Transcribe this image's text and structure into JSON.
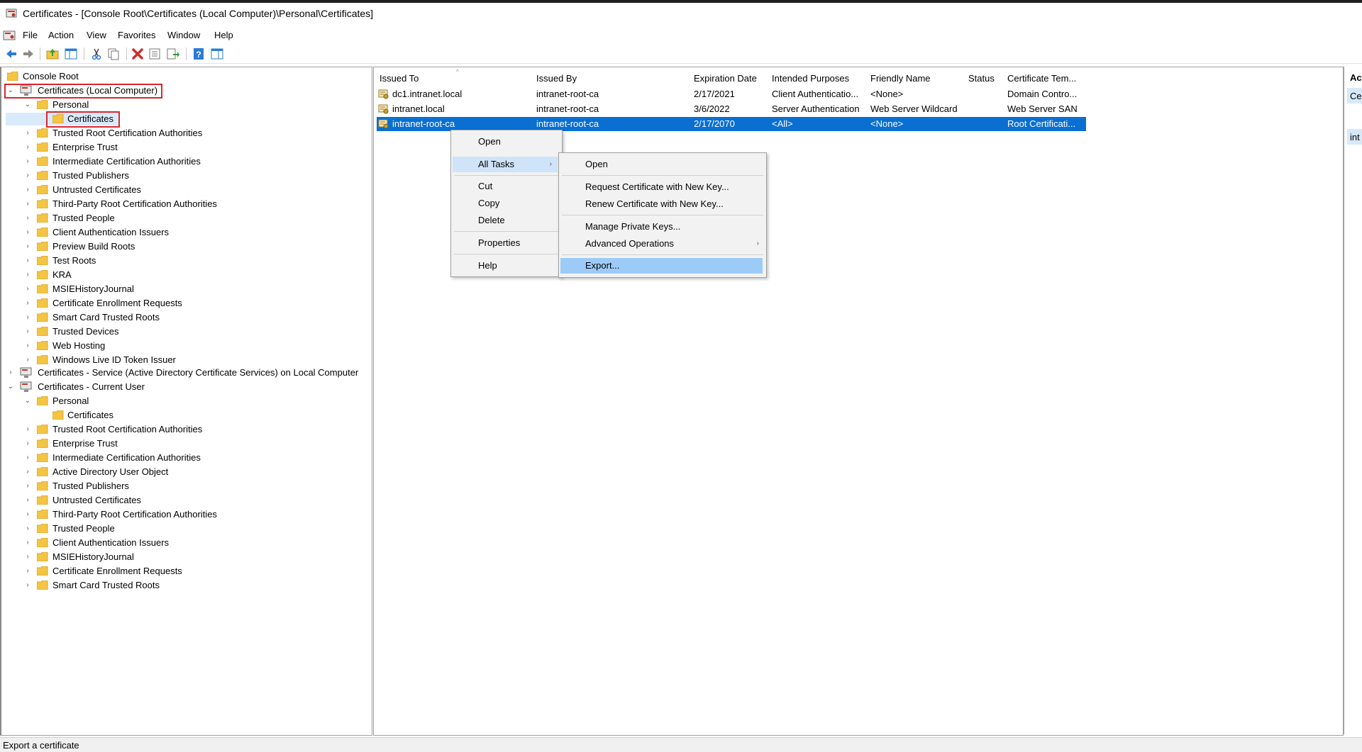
{
  "window": {
    "title": "Certificates - [Console Root\\Certificates (Local Computer)\\Personal\\Certificates]"
  },
  "menu": [
    "File",
    "Action",
    "View",
    "Favorites",
    "Window",
    "Help"
  ],
  "toolbar_icons": [
    "back-arrow-icon",
    "forward-arrow-icon",
    "up-folder-icon",
    "show-hide-tree-icon",
    "cut-icon",
    "copy-icon",
    "delete-icon",
    "properties-icon",
    "export-list-icon",
    "help-icon",
    "show-action-pane-icon"
  ],
  "tree": {
    "root": "Console Root",
    "local": {
      "label": "Certificates (Local Computer)",
      "personal": "Personal",
      "certificates": "Certificates",
      "folders": [
        "Trusted Root Certification Authorities",
        "Enterprise Trust",
        "Intermediate Certification Authorities",
        "Trusted Publishers",
        "Untrusted Certificates",
        "Third-Party Root Certification Authorities",
        "Trusted People",
        "Client Authentication Issuers",
        "Preview Build Roots",
        "Test Roots",
        "KRA",
        "MSIEHistoryJournal",
        "Certificate Enrollment Requests",
        "Smart Card Trusted Roots",
        "Trusted Devices",
        "Web Hosting",
        "Windows Live ID Token Issuer"
      ]
    },
    "service": {
      "label": "Certificates - Service (Active Directory Certificate Services) on Local Computer"
    },
    "user": {
      "label": "Certificates - Current User",
      "personal": "Personal",
      "certificates": "Certificates",
      "folders": [
        "Trusted Root Certification Authorities",
        "Enterprise Trust",
        "Intermediate Certification Authorities",
        "Active Directory User Object",
        "Trusted Publishers",
        "Untrusted Certificates",
        "Third-Party Root Certification Authorities",
        "Trusted People",
        "Client Authentication Issuers",
        "MSIEHistoryJournal",
        "Certificate Enrollment Requests",
        "Smart Card Trusted Roots"
      ]
    }
  },
  "list": {
    "columns": [
      "Issued To",
      "Issued By",
      "Expiration Date",
      "Intended Purposes",
      "Friendly Name",
      "Status",
      "Certificate Tem..."
    ],
    "rows": [
      {
        "issued_to": "dc1.intranet.local",
        "issued_by": "intranet-root-ca",
        "expiration": "2/17/2021",
        "purposes": "Client Authenticatio...",
        "friendly": "<None>",
        "status": "",
        "template": "Domain Contro..."
      },
      {
        "issued_to": "intranet.local",
        "issued_by": "intranet-root-ca",
        "expiration": "3/6/2022",
        "purposes": "Server Authentication",
        "friendly": "Web Server Wildcard",
        "status": "",
        "template": "Web Server SAN"
      },
      {
        "issued_to": "intranet-root-ca",
        "issued_by": "intranet-root-ca",
        "expiration": "2/17/2070",
        "purposes": "<All>",
        "friendly": "<None>",
        "status": "",
        "template": "Root Certificati..."
      }
    ],
    "selected_row": 2
  },
  "actions": {
    "header": "Act",
    "items": [
      "Ce",
      "int"
    ]
  },
  "context_menu": {
    "items": [
      "Open",
      "All Tasks",
      "Cut",
      "Copy",
      "Delete",
      "Properties",
      "Help"
    ],
    "submenu": [
      "Open",
      "Request Certificate with New Key...",
      "Renew Certificate with New Key...",
      "Manage Private Keys...",
      "Advanced Operations",
      "Export..."
    ]
  },
  "status": "Export a certificate",
  "colors": {
    "selection": "#0a6fd1",
    "highlight_box": "#d9272e",
    "folder": "#f5c542"
  }
}
